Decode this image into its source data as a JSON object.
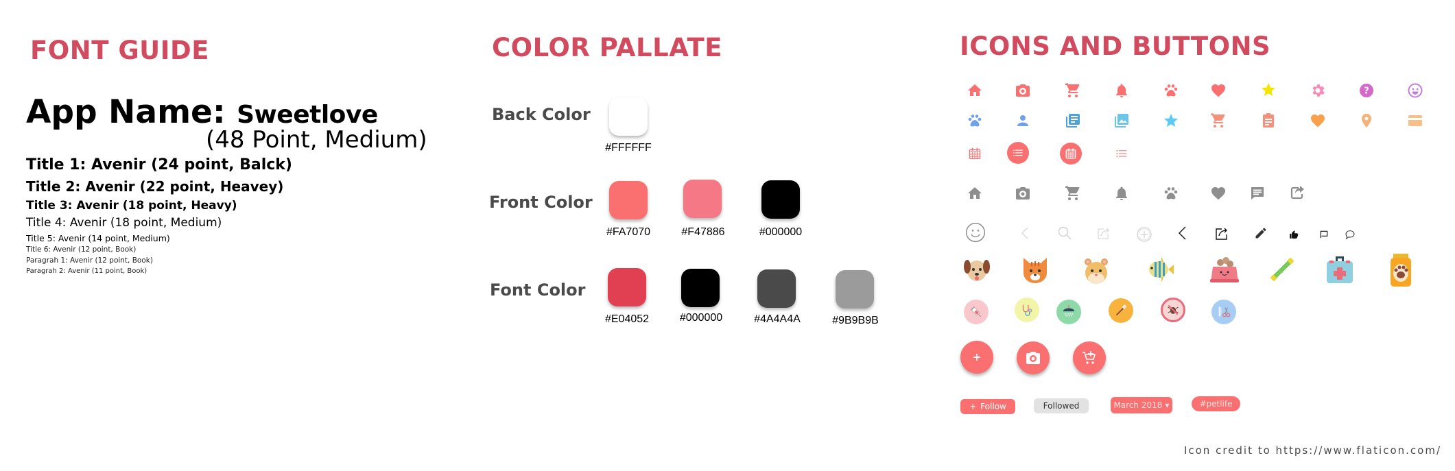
{
  "font_guide": {
    "heading": "FONT GUIDE",
    "app_name_label": "App Name:",
    "app_name": "Sweetlove",
    "app_name_spec": "(48 Point, Medium)",
    "styles": [
      {
        "label": "Title 1: Avenir (24 point, Balck)"
      },
      {
        "label": "Title 2: Avenir (22 point, Heavey)"
      },
      {
        "label": "Title 3: Avenir (18 point, Heavy)"
      },
      {
        "label": "Title 4: Avenir (18 point, Medium)"
      },
      {
        "label": "Title 5: Avenir (14 point, Medium)"
      },
      {
        "label": "Title 6: Avenir (12 point, Book)"
      },
      {
        "label": "Paragrah 1: Avenir (12 point, Book)"
      },
      {
        "label": "Paragrah 2: Avenir (11 point, Book)"
      }
    ]
  },
  "color_palette": {
    "heading": "COLOR PALLATE",
    "groups": [
      {
        "label": "Back Color",
        "colors": [
          {
            "hex": "#FFFFFF"
          }
        ]
      },
      {
        "label": "Front Color",
        "colors": [
          {
            "hex": "#FA7070"
          },
          {
            "hex": "#F47886"
          },
          {
            "hex": "#000000"
          }
        ]
      },
      {
        "label": "Font Color",
        "colors": [
          {
            "hex": "#E04052"
          },
          {
            "hex": "#000000"
          },
          {
            "hex": "#4A4A4A"
          },
          {
            "hex": "#9B9B9B"
          }
        ]
      }
    ]
  },
  "icons_buttons": {
    "heading": "ICONS AND BUTTONS",
    "row1": [
      "home-icon",
      "camera-icon",
      "cart-icon",
      "bell-icon",
      "paw-icon",
      "heart-icon",
      "star-icon",
      "gear-icon",
      "help-icon",
      "smiley-icon"
    ],
    "row1_colors": [
      "#FA7070",
      "#FA7070",
      "#FA7070",
      "#FA7070",
      "#FA7070",
      "#FA7070",
      "#F5E400",
      "#F58CB8",
      "#D36AC9",
      "#C77BE0"
    ],
    "row2": [
      "paw-icon",
      "person-icon",
      "newspaper-icon",
      "gallery-icon",
      "star-icon",
      "cart-icon",
      "clipboard-icon",
      "heart-icon",
      "location-pin-icon",
      "credit-card-icon"
    ],
    "row2_colors": [
      "#6FA0E8",
      "#6FA0E8",
      "#4FA3D6",
      "#6DC3E8",
      "#5EC9F2",
      "#F5907A",
      "#F5907A",
      "#F9A04A",
      "#F5B27A",
      "#F5C08A"
    ],
    "row3": [
      "calendar-icon",
      "list-icon",
      "calendar-icon",
      "list-icon"
    ],
    "row4": [
      "home-icon",
      "camera-icon",
      "cart-icon",
      "bell-icon",
      "paw-icon",
      "heart-icon",
      "comment-icon",
      "share-icon"
    ],
    "row5": [
      "smiley-outline-icon",
      "back-icon",
      "search-icon",
      "share-outline-icon",
      "add-circle-icon",
      "back-icon",
      "share-outline-icon",
      "pencil-icon",
      "thumbs-up-icon",
      "flag-comment-icon",
      "speech-bubble-icon"
    ],
    "pets": [
      "dog-icon",
      "cat-icon",
      "hamster-icon",
      "fish-icon",
      "pet-food-bowl-icon",
      "chew-toy-icon",
      "first-aid-kit-icon",
      "pet-food-bag-icon"
    ],
    "services": [
      {
        "name": "vaccine-icon",
        "color": "#F8C8CC"
      },
      {
        "name": "stethoscope-icon",
        "color": "#F2F5A8"
      },
      {
        "name": "shower-icon",
        "color": "#8ED9A8"
      },
      {
        "name": "brush-icon",
        "color": "#F7B33E"
      },
      {
        "name": "no-flea-icon",
        "color": "#F7D6D6"
      },
      {
        "name": "grooming-icon",
        "color": "#A8CDF5"
      }
    ],
    "fabs": [
      "add-icon",
      "camera-icon",
      "add-to-cart-icon"
    ],
    "buttons": {
      "follow": "Follow",
      "followed": "Followed",
      "month": "March 2018",
      "hashtag": "#petlife"
    },
    "accent": "#FA7070"
  },
  "credit": "Icon credit to https://www.flaticon.com/"
}
